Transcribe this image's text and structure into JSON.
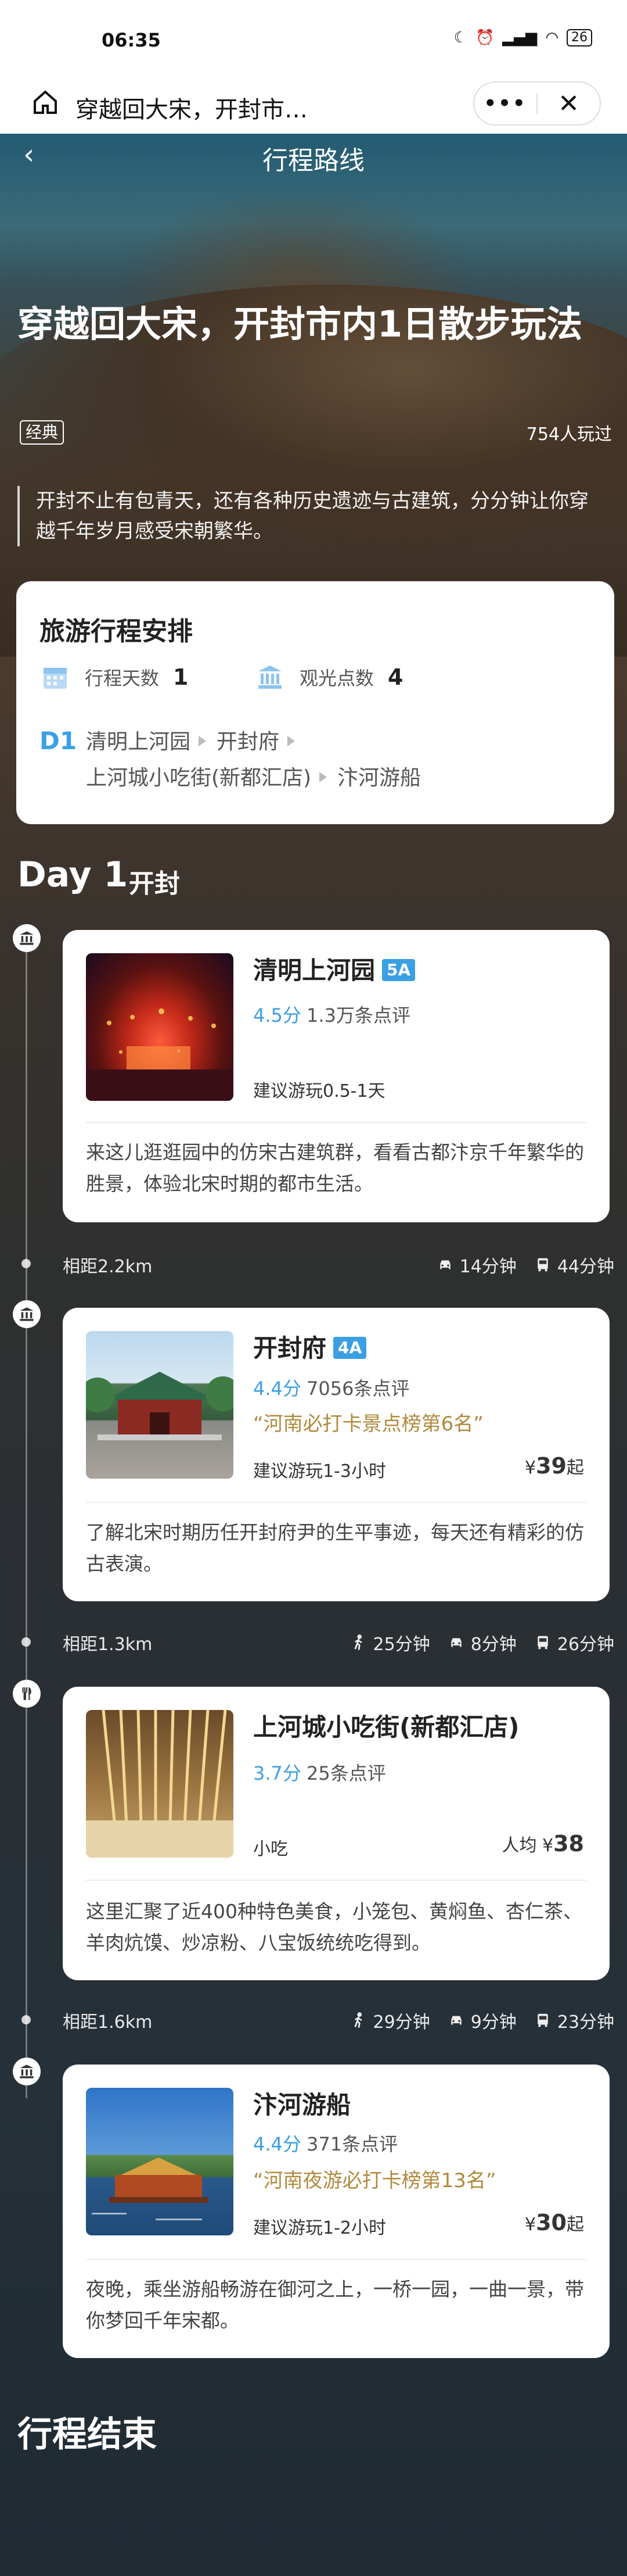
{
  "status_bar": {
    "time": "06:35",
    "battery": "26"
  },
  "browser": {
    "page_title": "穿越回大宋，开封市…",
    "more_label": "•••",
    "close_label": "✕"
  },
  "header": {
    "title": "行程路线",
    "back_label": "‹"
  },
  "hero": {
    "title": "穿越回大宋，开封市内1日散步玩法",
    "tag": "经典",
    "played": "754人玩过",
    "intro": "开封不止有包青天，还有各种历史遗迹与古建筑，分分钟让你穿越千年岁月感受宋朝繁华。"
  },
  "overview": {
    "heading": "旅游行程安排",
    "days_label": "行程天数",
    "days_value": "1",
    "spots_label": "观光点数",
    "spots_value": "4",
    "day_label": "D1",
    "route": [
      "清明上河园",
      "开封府",
      "上河城小吃街(新都汇店)",
      "汴河游船"
    ]
  },
  "day": {
    "label": "Day 1",
    "city": "开封"
  },
  "pois": [
    {
      "name": "清明上河园",
      "level": "5A",
      "score": "4.5分",
      "reviews": "1.3万条点评",
      "rank": "",
      "sub": "建议游玩0.5-1天",
      "price_prefix": "",
      "price": "",
      "price_suffix": "",
      "desc": "来这儿逛逛园中的仿宋古建筑群，看看古都汴京千年繁华的胜景，体验北宋时期的都市生活。",
      "icon": "museum-icon"
    },
    {
      "name": "开封府",
      "level": "4A",
      "score": "4.4分",
      "reviews": "7056条点评",
      "rank": "“河南必打卡景点榜第6名”",
      "sub": "建议游玩1-3小时",
      "price_prefix": "¥",
      "price": "39",
      "price_suffix": "起",
      "desc": "了解北宋时期历任开封府尹的生平事迹，每天还有精彩的仿古表演。",
      "icon": "museum-icon"
    },
    {
      "name": "上河城小吃街(新都汇店)",
      "level": "",
      "score": "3.7分",
      "reviews": "25条点评",
      "rank": "",
      "sub": "小吃",
      "price_prefix": "人均 ¥",
      "price": "38",
      "price_suffix": "",
      "desc": "这里汇聚了近400种特色美食，小笼包、黄焖鱼、杏仁茶、羊肉炕馍、炒凉粉、八宝饭统统吃得到。",
      "icon": "restaurant-icon"
    },
    {
      "name": "汴河游船",
      "level": "",
      "score": "4.4分",
      "reviews": "371条点评",
      "rank": "“河南夜游必打卡榜第13名”",
      "sub": "建议游玩1-2小时",
      "price_prefix": "¥",
      "price": "30",
      "price_suffix": "起",
      "desc": "夜晚，乘坐游船畅游在御河之上，一桥一园，一曲一景，带你梦回千年宋都。",
      "icon": "museum-icon"
    }
  ],
  "distances": [
    {
      "distance": "相距2.2km",
      "walk": "",
      "car": "14分钟",
      "bus": "44分钟"
    },
    {
      "distance": "相距1.3km",
      "walk": "25分钟",
      "car": "8分钟",
      "bus": "26分钟"
    },
    {
      "distance": "相距1.6km",
      "walk": "29分钟",
      "car": "9分钟",
      "bus": "23分钟"
    }
  ],
  "footer": {
    "end_label": "行程结束"
  }
}
